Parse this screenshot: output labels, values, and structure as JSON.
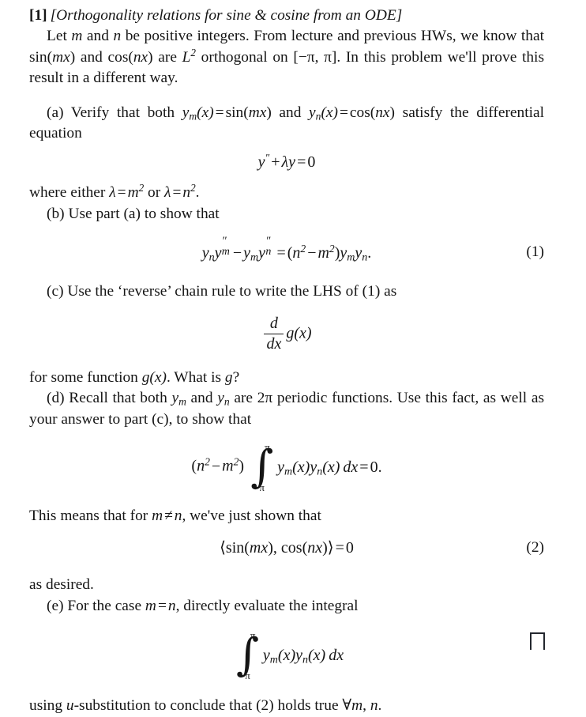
{
  "problem": {
    "label": "[1]",
    "title": "[Orthogonality relations for sine & cosine from an ODE]"
  },
  "intro": {
    "t1": "Let ",
    "m1": "m",
    "t2": " and ",
    "m2": "n",
    "t3": " be positive integers. From lecture and previous HWs, we know that ",
    "fn1": "sin(",
    "fn1v": "mx",
    "fn1c": ")",
    "t4": " and ",
    "fn2": "cos(",
    "fn2v": "nx",
    "fn2c": ")",
    "t5": " are ",
    "space": "L",
    "space_exp": "2",
    "t6": " orthogonal on ",
    "interval": "[−π, π]",
    "t7": ". In this problem we'll prove this result in a different way."
  },
  "parts": {
    "a": {
      "label": "(a)",
      "text_before": " Verify that both ",
      "ym": "y",
      "ym_sub": "m",
      "ym_arg": "(x)",
      "eq": "=",
      "ym_def": "sin(",
      "ym_def_var": "mx",
      "ym_def_close": ")",
      "and": " and ",
      "yn": "y",
      "yn_sub": "n",
      "yn_arg": "(x)",
      "yn_def": "cos(",
      "yn_def_var": "nx",
      "yn_def_close": ")",
      "text_after": " satisfy the differential equation",
      "where_pre": "where either ",
      "lambda": "λ",
      "where_eq1": "=",
      "where_m": "m",
      "where_m_exp": "2",
      "where_or": " or ",
      "where_n": "n",
      "where_n_exp": "2",
      "where_end": "."
    },
    "b": {
      "label": "(b)",
      "text": " Use part (a) to show that"
    },
    "c": {
      "label": "(c)",
      "text": " Use the ‘reverse’ chain rule to write the LHS of (1) as",
      "after_pre": "for some function ",
      "after_g": "g",
      "after_garg": "(x)",
      "after_mid": ". What is ",
      "after_g2": "g",
      "after_end": "?"
    },
    "d": {
      "label": "(d)",
      "text_pre": " Recall that both ",
      "ym": "y",
      "ym_sub": "m",
      "mid": " and ",
      "yn": "y",
      "yn_sub": "n",
      "text_post": " are 2π periodic functions. Use this fact, as well as your answer to part (c), to show that"
    },
    "e": {
      "label": "(e)",
      "text_pre": " For the case ",
      "m": "m",
      "eq": "=",
      "n": "n",
      "text_post": ", directly evaluate the integral"
    }
  },
  "equations": {
    "ode": {
      "y": "y",
      "prime": "″",
      "plus": "+",
      "lambda": "λ",
      "y2": "y",
      "eq": "=",
      "zero": "0"
    },
    "eq1": {
      "number": "(1)",
      "yn": "y",
      "yn_sub": "n",
      "ym_pp": "y",
      "ym_pp_prime": "″",
      "ym_pp_sub": "m",
      "minus": "−",
      "ym": "y",
      "ym_sub": "m",
      "yn_pp": "y",
      "yn_pp_prime": "″",
      "yn_pp_sub": "n",
      "eq": "=",
      "open": "(",
      "n": "n",
      "n_exp": "2",
      "minus2": "−",
      "m": "m",
      "m_exp": "2",
      "close": ")",
      "ym2": "y",
      "ym2_sub": "m",
      "yn2": "y",
      "yn2_sub": "n",
      "period": "."
    },
    "ddx": {
      "num": "d",
      "den": "dx",
      "g": "g",
      "garg": "(x)"
    },
    "integral_d": {
      "open": "(",
      "n": "n",
      "n_exp": "2",
      "minus": "−",
      "m": "m",
      "m_exp": "2",
      "close": ")",
      "upper": "π",
      "lower": "−π",
      "int_sym": "∫",
      "ym": "y",
      "ym_sub": "m",
      "ym_arg": "(x)",
      "yn": "y",
      "yn_sub": "n",
      "yn_arg": "(x)",
      "dx": "dx",
      "eq": "=",
      "zero": "0",
      "period": "."
    },
    "eq2": {
      "number": "(2)",
      "open": "⟨",
      "sin": "sin(",
      "sin_var": "mx",
      "sin_close": ")",
      "comma": ", ",
      "cos": "cos(",
      "cos_var": "nx",
      "cos_close": ")",
      "close": "⟩",
      "eq": "=",
      "zero": "0"
    },
    "integral_e": {
      "upper": "π",
      "lower": "−π",
      "int_sym": "∫",
      "ym": "y",
      "ym_sub": "m",
      "ym_arg": "(x)",
      "yn": "y",
      "yn_sub": "n",
      "yn_arg": "(x)",
      "dx": "dx"
    }
  },
  "conclusions": {
    "means_pre": "This means that for ",
    "m": "m",
    "neq": "≠",
    "n": "n",
    "means_post": ", we've just shown that",
    "as_desired": "as desired.",
    "final_pre": "using ",
    "final_u": "u",
    "final_mid": "-substitution to conclude that (2) holds true ",
    "forall": "∀",
    "final_m": "m",
    "final_comma": ", ",
    "final_n": "n",
    "final_end": "."
  },
  "qed_symbol": "□"
}
